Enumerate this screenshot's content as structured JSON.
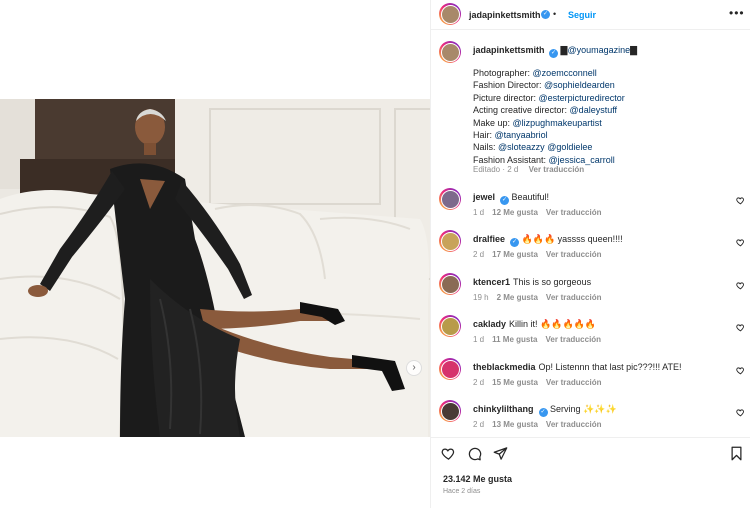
{
  "post": {
    "username": "jadapinkettsmith",
    "dot": "•",
    "follow_label": "Seguir",
    "more_label": "•••"
  },
  "caption": {
    "username": "jadapinkettsmith",
    "tag_prefix": "▇",
    "tag_mention": "@youmagazine",
    "tag_suffix": "▇",
    "credits": [
      {
        "role": "Photographer: ",
        "handle": "@zoemcconnell"
      },
      {
        "role": "Fashion Director: ",
        "handle": "@sophieldearden"
      },
      {
        "role": "Picture director: ",
        "handle": "@esterpicturedirector"
      },
      {
        "role": "Acting creative director: ",
        "handle": "@daleystuff"
      },
      {
        "role": "Make up: ",
        "handle": "@lizpughmakeupartist"
      },
      {
        "role": "Hair: ",
        "handle": "@tanyaabriol"
      },
      {
        "role": "Nails: ",
        "handle": "@sloteazzy",
        "handle2": "@goldielee",
        "joiner": " "
      },
      {
        "role": "Fashion Assistant: ",
        "handle": "@jessica_carroll"
      }
    ],
    "meta_edited": "Editado · 2 d",
    "meta_translate": "Ver traducción"
  },
  "comments": [
    {
      "user": "jewel",
      "verified": true,
      "text": "Beautiful!",
      "time": "1 d",
      "likes": "12 Me gusta",
      "translate": "Ver traducción",
      "avatar_color": "#7d6a8c"
    },
    {
      "user": "dralfiee",
      "verified": true,
      "text": "🔥🔥🔥 yassss queen!!!!",
      "time": "2 d",
      "likes": "17 Me gusta",
      "translate": "Ver traducción",
      "avatar_color": "#c8a35a"
    },
    {
      "user": "ktencer1",
      "verified": false,
      "text": "This is so gorgeous",
      "time": "19 h",
      "likes": "2 Me gusta",
      "translate": "Ver traducción",
      "avatar_color": "#8a6b55"
    },
    {
      "user": "caklady",
      "verified": false,
      "text": "Killin it! 🔥🔥🔥🔥🔥",
      "time": "1 d",
      "likes": "11 Me gusta",
      "translate": "Ver traducción",
      "avatar_color": "#b89b4a"
    },
    {
      "user": "theblackmedia",
      "verified": false,
      "text": "Op! Listennn that last pic???!!! ATE!",
      "time": "2 d",
      "likes": "15 Me gusta",
      "translate": "Ver traducción",
      "avatar_color": "#d6336c"
    },
    {
      "user": "chinkylilthang",
      "verified": true,
      "text": "Serving ✨✨✨",
      "time": "2 d",
      "likes": "13 Me gusta",
      "translate": "Ver traducción",
      "avatar_color": "#4a3a35"
    }
  ],
  "footer": {
    "likes": "23.142 Me gusta",
    "time": "Hace 2 días"
  },
  "colors": {
    "link": "#00376b",
    "follow": "#0095f6",
    "verified": "#3897f0",
    "muted": "#8e8e8e"
  },
  "icons": [
    "heart-icon",
    "comment-icon",
    "share-icon",
    "bookmark-icon",
    "chevron-right-icon",
    "more-icon",
    "verified-icon"
  ]
}
